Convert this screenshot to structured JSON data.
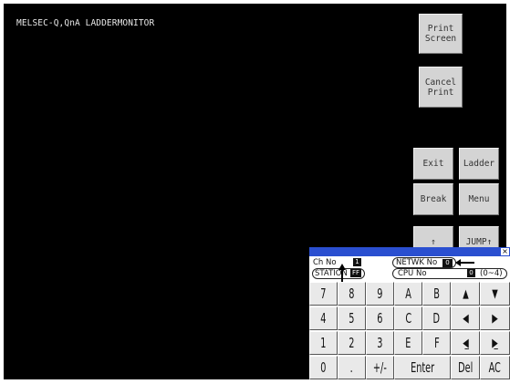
{
  "title": "MELSEC-Q,QnA LADDERMONITOR",
  "buttons": {
    "print_screen": "Print\nScreen",
    "cancel_print": "Cancel\nPrint",
    "exit": "Exit",
    "ladder": "Ladder",
    "break": "Break",
    "menu": "Menu",
    "up_arrow": "↑",
    "jump_up": "JUMP↑"
  },
  "keypad": {
    "close": "×",
    "ch_no_label": "Ch No",
    "ch_no_value": "1",
    "station_label": "STATION",
    "station_value": "FF",
    "netwk_label": "NETWK No",
    "netwk_value": "0",
    "cpu_label": "CPU No",
    "cpu_value": "0",
    "cpu_range": "(0~4)",
    "keys": {
      "k7": "7",
      "k8": "8",
      "k9": "9",
      "kA": "A",
      "kB": "B",
      "up": "▲",
      "down": "▼",
      "k4": "4",
      "k5": "5",
      "k6": "6",
      "kC": "C",
      "kD": "D",
      "left": "◀",
      "right": "▶",
      "k1": "1",
      "k2": "2",
      "k3": "3",
      "kE": "E",
      "kF": "F",
      "back": "◀̲",
      "fwd": "▶̲",
      "k0": "0",
      "dot": ".",
      "sign": "+/-",
      "enter": "Enter",
      "del": "Del",
      "ac": "AC"
    }
  }
}
